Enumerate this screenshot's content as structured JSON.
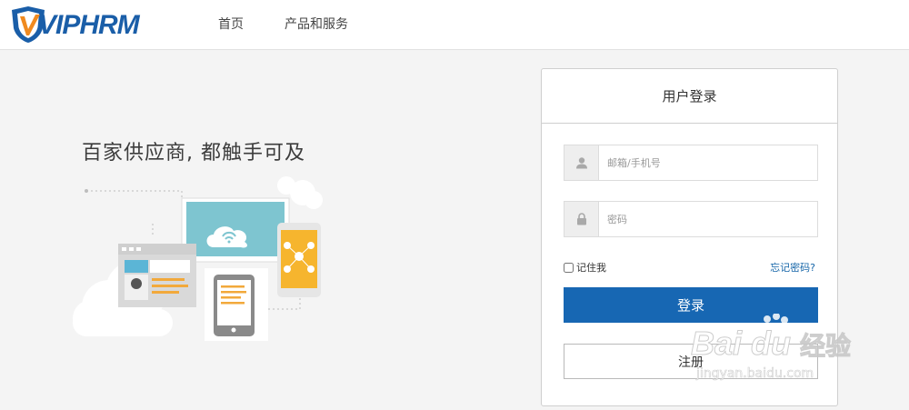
{
  "header": {
    "logo_text": "VIPHRM",
    "nav": {
      "home": "首页",
      "products": "产品和服务"
    }
  },
  "hero": {
    "slogan": "百家供应商, 都触手可及"
  },
  "login": {
    "title": "用户登录",
    "username_placeholder": "邮箱/手机号",
    "password_placeholder": "密码",
    "remember_label": "记住我",
    "forgot_link": "忘记密码?",
    "login_button": "登录",
    "register_button": "注册"
  },
  "watermark": {
    "brand": "Bai du",
    "brand_cn": "经验",
    "url": "jingyan.baidu.com"
  },
  "colors": {
    "brand_blue": "#1767b3",
    "logo_orange": "#f08a1f",
    "page_bg": "#f4f4f4"
  }
}
